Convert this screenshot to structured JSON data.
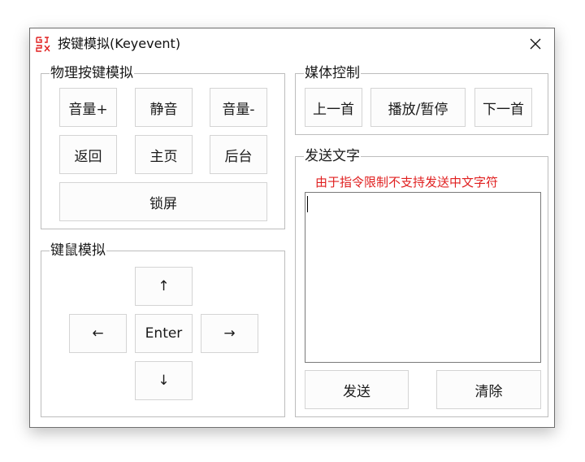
{
  "window": {
    "title": "按键模拟(Keyevent)",
    "icon": "gj-logo-icon",
    "accent_color": "#e02020",
    "close_icon": "close-icon"
  },
  "physical_keys": {
    "title": "物理按键模拟",
    "vol_up": "音量+",
    "mute": "静音",
    "vol_down": "音量-",
    "back": "返回",
    "home": "主页",
    "recents": "后台",
    "lock": "锁屏"
  },
  "keyboard_mouse": {
    "title": "键鼠模拟",
    "up": "↑",
    "left": "←",
    "enter": "Enter",
    "right": "→",
    "down": "↓"
  },
  "media": {
    "title": "媒体控制",
    "prev": "上一首",
    "play_pause": "播放/暂停",
    "next": "下一首"
  },
  "send_text": {
    "title": "发送文字",
    "warning": "由于指令限制不支持发送中文字符",
    "input_value": "",
    "send": "发送",
    "clear": "清除"
  }
}
